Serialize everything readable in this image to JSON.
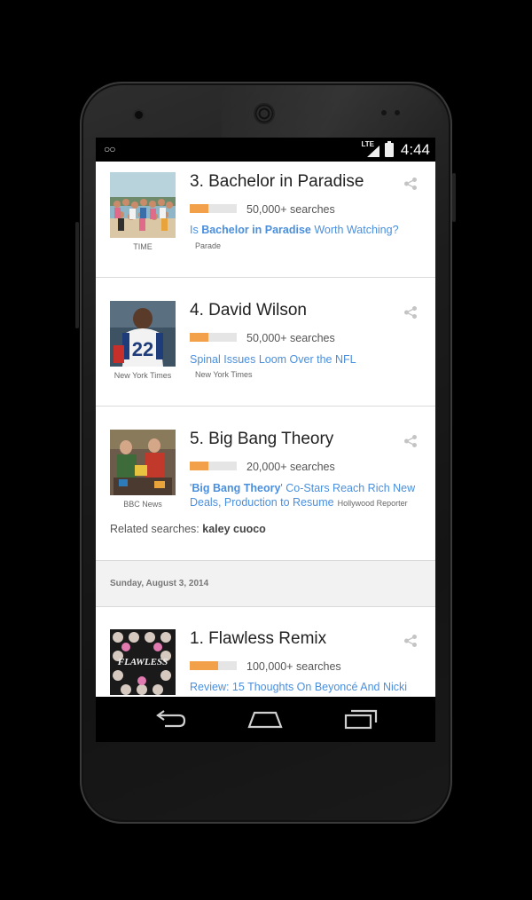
{
  "status_bar": {
    "network": "LTE",
    "time": "4:44"
  },
  "feed": {
    "cards": [
      {
        "rank_title": "3. Bachelor in Paradise",
        "searches": "50,000+ searches",
        "bar_fraction": 0.4,
        "image_source": "TIME",
        "headline_bold": "Bachelor in Paradise",
        "headline_pre": "Is ",
        "headline_post": " Worth Watching?",
        "publisher": "Parade"
      },
      {
        "rank_title": "4. David Wilson",
        "searches": "50,000+ searches",
        "bar_fraction": 0.4,
        "image_source": "New York Times",
        "headline": "Spinal Issues Loom Over the NFL",
        "publisher": "New York Times"
      },
      {
        "rank_title": "5. Big Bang Theory",
        "searches": "20,000+ searches",
        "bar_fraction": 0.4,
        "image_source": "BBC News",
        "headline_pre": "'",
        "headline_bold": "Big Bang Theory",
        "headline_post": "' Co-Stars Reach Rich New Deals, Production to Resume",
        "publisher": "Hollywood Reporter",
        "related_label": "Related searches:",
        "related_term": "kaley cuoco"
      },
      {
        "rank_title": "1. Flawless Remix",
        "searches": "100,000+ searches",
        "bar_fraction": 0.6,
        "headline": "Review: 15 Thoughts On Beyoncé And Nicki"
      }
    ],
    "day_header": "Sunday, August 3, 2014"
  },
  "colors": {
    "bar_fill": "#f2a04a",
    "link": "#4a8fde"
  }
}
